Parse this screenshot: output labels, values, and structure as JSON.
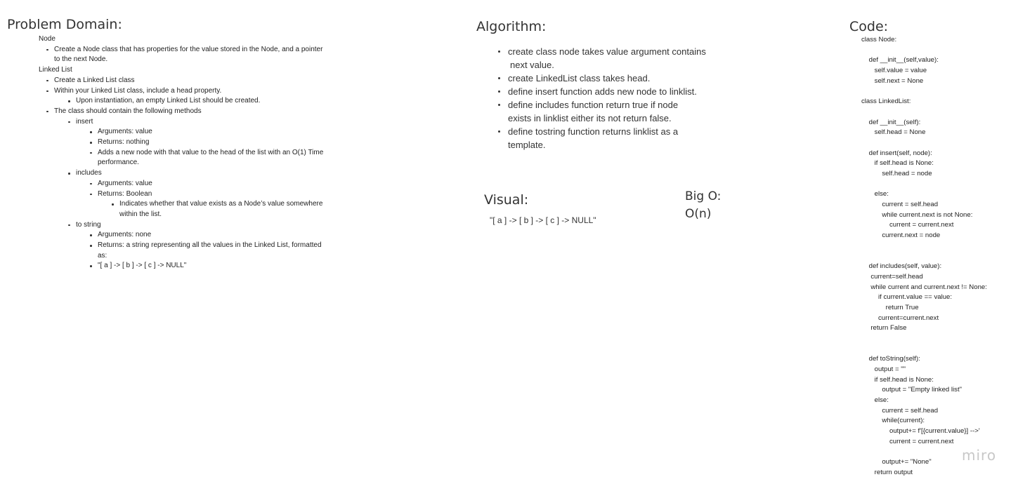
{
  "problem_domain": {
    "title": "Problem Domain:",
    "node_label": "Node",
    "node_items": [
      "Create a Node class that has properties for the value stored in the Node, and a pointer",
      "to the next Node."
    ],
    "linked_list_label": "Linked List",
    "ll_item1": "Create a Linked List class",
    "ll_item2": "Within your Linked List class, include a head property.",
    "ll_item2_sub": "Upon instantiation, an empty Linked List should be created.",
    "ll_item3": "The class should contain the following methods",
    "insert": {
      "label": "insert",
      "args": "Arguments: value",
      "returns": "Returns: nothing",
      "desc1": "Adds a new node with that value to the head of the list with an O(1) Time",
      "desc2": "performance."
    },
    "includes": {
      "label": "includes",
      "args": "Arguments: value",
      "returns": "Returns: Boolean",
      "desc1": "Indicates whether that value exists as a Node’s value somewhere",
      "desc2": "within the list."
    },
    "to_string": {
      "label": "to string",
      "args": "Arguments: none",
      "returns1": "Returns: a string representing all the values in the Linked List, formatted",
      "returns2": "as:",
      "example": "\"[ a ] -> [ b ] -> [ c ] -> NULL\""
    }
  },
  "algorithm": {
    "title": "Algorithm:",
    "items": [
      {
        "line1": "create class node takes value argument contains",
        "line2": " next value."
      },
      {
        "line1": "create LinkedList class takes head.",
        "line2": ""
      },
      {
        "line1": "define insert function adds new node to linklist.",
        "line2": ""
      },
      {
        "line1": "define includes function return true if node",
        "line2": "exists in linklist either its not return false."
      },
      {
        "line1": "define tostring function returns linklist as a",
        "line2": "template."
      }
    ]
  },
  "visual": {
    "title": "Visual:",
    "example": "\"[ a ] -> [ b ] -> [ c ] -> NULL\""
  },
  "big_o": {
    "title": "Big O:",
    "value": "O(n)"
  },
  "code": {
    "title": "Code:",
    "lines": [
      "class Node:",
      "",
      "    def __init__(self,value):",
      "       self.value = value",
      "       self.next = None",
      "",
      "class LinkedList:",
      "",
      "    def __init__(self):",
      "       self.head = None",
      "",
      "    def insert(self, node):",
      "       if self.head is None:",
      "           self.head = node",
      "",
      "       else:",
      "           current = self.head",
      "           while current.next is not None:",
      "               current = current.next",
      "           current.next = node",
      "",
      "",
      "    def includes(self, value):",
      "     current=self.head",
      "     while current and current.next != None:",
      "         if current.value == value:",
      "             return True",
      "         current=current.next",
      "     return False",
      "",
      "",
      "    def toString(self):",
      "       output = \"\"",
      "       if self.head is None:",
      "           output = \"Empty linked list\"",
      "       else:",
      "           current = self.head",
      "           while(current):",
      "               output+= f'[{current.value}] -->'",
      "               current = current.next",
      "",
      "           output+= \"None\"",
      "       return output"
    ]
  },
  "branding": {
    "logo": "miro"
  }
}
